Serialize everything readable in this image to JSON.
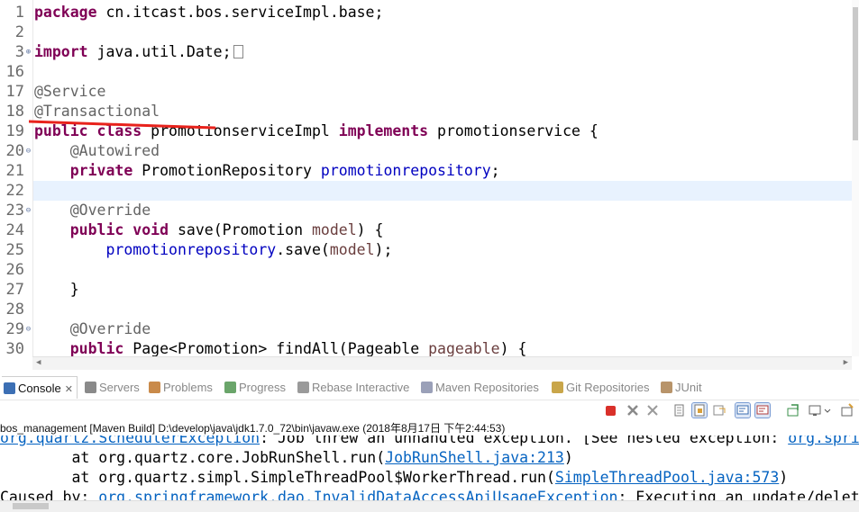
{
  "editor": {
    "lines": [
      {
        "num": "1",
        "fold": "",
        "segs": [
          {
            "t": "package",
            "c": "kw"
          },
          {
            "t": " cn.itcast.bos.serviceImpl.base;",
            "c": ""
          }
        ]
      },
      {
        "num": "2",
        "fold": "",
        "segs": []
      },
      {
        "num": "3",
        "fold": "⊕",
        "segs": [
          {
            "t": "import",
            "c": "kw"
          },
          {
            "t": " java.util.Date;",
            "c": ""
          }
        ],
        "box": true
      },
      {
        "num": "16",
        "fold": "",
        "segs": []
      },
      {
        "num": "17",
        "fold": "",
        "segs": [
          {
            "t": "@Service",
            "c": "ann"
          }
        ]
      },
      {
        "num": "18",
        "fold": "",
        "segs": [
          {
            "t": "@Transactional",
            "c": "ann"
          }
        ]
      },
      {
        "num": "19",
        "fold": "",
        "segs": [
          {
            "t": "public",
            "c": "kw"
          },
          {
            "t": " ",
            "c": ""
          },
          {
            "t": "class",
            "c": "kw"
          },
          {
            "t": " promotionserviceImpl ",
            "c": ""
          },
          {
            "t": "implements",
            "c": "kw"
          },
          {
            "t": " promotionservice {",
            "c": ""
          }
        ]
      },
      {
        "num": "20",
        "fold": "⊖",
        "segs": [
          {
            "t": "    ",
            "c": ""
          },
          {
            "t": "@Autowired",
            "c": "ann"
          }
        ]
      },
      {
        "num": "21",
        "fold": "",
        "segs": [
          {
            "t": "    ",
            "c": ""
          },
          {
            "t": "private",
            "c": "kw"
          },
          {
            "t": " PromotionRepository ",
            "c": ""
          },
          {
            "t": "promotionrepository",
            "c": "fld"
          },
          {
            "t": ";",
            "c": ""
          }
        ]
      },
      {
        "num": "22",
        "fold": "",
        "segs": [],
        "current": true
      },
      {
        "num": "23",
        "fold": "⊖",
        "segs": [
          {
            "t": "    ",
            "c": ""
          },
          {
            "t": "@Override",
            "c": "ann"
          }
        ]
      },
      {
        "num": "24",
        "fold": "",
        "segs": [
          {
            "t": "    ",
            "c": ""
          },
          {
            "t": "public",
            "c": "kw"
          },
          {
            "t": " ",
            "c": ""
          },
          {
            "t": "void",
            "c": "kw"
          },
          {
            "t": " save(Promotion ",
            "c": ""
          },
          {
            "t": "model",
            "c": "par"
          },
          {
            "t": ") {",
            "c": ""
          }
        ]
      },
      {
        "num": "25",
        "fold": "",
        "segs": [
          {
            "t": "        ",
            "c": ""
          },
          {
            "t": "promotionrepository",
            "c": "fld"
          },
          {
            "t": ".save(",
            "c": ""
          },
          {
            "t": "model",
            "c": "par"
          },
          {
            "t": ");",
            "c": ""
          }
        ]
      },
      {
        "num": "26",
        "fold": "",
        "segs": []
      },
      {
        "num": "27",
        "fold": "",
        "segs": [
          {
            "t": "    }",
            "c": ""
          }
        ]
      },
      {
        "num": "28",
        "fold": "",
        "segs": []
      },
      {
        "num": "29",
        "fold": "⊖",
        "segs": [
          {
            "t": "    ",
            "c": ""
          },
          {
            "t": "@Override",
            "c": "ann"
          }
        ]
      },
      {
        "num": "30",
        "fold": "",
        "segs": [
          {
            "t": "    ",
            "c": ""
          },
          {
            "t": "public",
            "c": "kw"
          },
          {
            "t": " Page<Promotion> findAll(Pageable ",
            "c": ""
          },
          {
            "t": "pageable",
            "c": "par"
          },
          {
            "t": ") {",
            "c": ""
          }
        ]
      }
    ]
  },
  "tabs": [
    {
      "label": "Console",
      "icon": "console-icon",
      "active": true,
      "color": "#3c6fb4"
    },
    {
      "label": "Servers",
      "icon": "servers-icon",
      "color": "#8a8a8a"
    },
    {
      "label": "Problems",
      "icon": "problems-icon",
      "color": "#c98a4a"
    },
    {
      "label": "Progress",
      "icon": "progress-icon",
      "color": "#6aa56a"
    },
    {
      "label": "Rebase Interactive",
      "icon": "rebase-icon",
      "color": "#9a9a9a"
    },
    {
      "label": "Maven Repositories",
      "icon": "maven-icon",
      "color": "#9aa0b8"
    },
    {
      "label": "Git Repositories",
      "icon": "git-icon",
      "color": "#c9a64a"
    },
    {
      "label": "JUnit",
      "icon": "junit-icon",
      "color": "#b8946a"
    }
  ],
  "console": {
    "process": "bos_management [Maven Build] D:\\develop\\java\\jdk1.7.0_72\\bin\\javaw.exe (2018年8月17日 下午2:44:53)",
    "lines": [
      [
        {
          "t": "org.quartz.SchedulerException",
          "c": "lnk"
        },
        {
          "t": ": Job threw an unhandled exception. [See nested exception: ",
          "c": ""
        },
        {
          "t": "org.springframework",
          "c": "lnk"
        }
      ],
      [
        {
          "t": "        at org.quartz.core.JobRunShell.run(",
          "c": ""
        },
        {
          "t": "JobRunShell.java:213",
          "c": "lnk"
        },
        {
          "t": ")",
          "c": ""
        }
      ],
      [
        {
          "t": "        at org.quartz.simpl.SimpleThreadPool$WorkerThread.run(",
          "c": ""
        },
        {
          "t": "SimpleThreadPool.java:573",
          "c": "lnk"
        },
        {
          "t": ")",
          "c": ""
        }
      ],
      [
        {
          "t": "Caused by: ",
          "c": ""
        },
        {
          "t": "org.springframework.dao.InvalidDataAccessApiUsageException",
          "c": "lnk"
        },
        {
          "t": ": Executing an update/delete query",
          "c": ""
        }
      ]
    ]
  },
  "colors": {
    "keyword": "#7f0055",
    "annotation": "#646464",
    "field": "#0000c0",
    "param": "#6a3e3e",
    "link": "#0563c1",
    "highlight": "#e8f2fe",
    "underline": "#e8221c"
  }
}
